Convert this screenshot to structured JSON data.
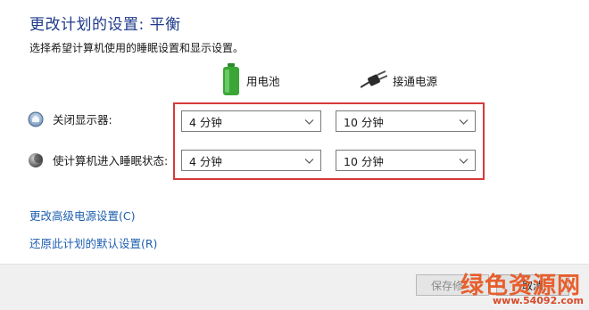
{
  "header": {
    "title": "更改计划的设置: 平衡",
    "subtitle": "选择希望计算机使用的睡眠设置和显示设置。"
  },
  "columns": {
    "battery_label": "用电池",
    "plugged_label": "接通电源",
    "battery_icon": "battery-icon",
    "plugged_icon": "power-plug-icon"
  },
  "settings": [
    {
      "label": "关闭显示器:",
      "icon": "display-icon",
      "battery_value": "4 分钟",
      "plugged_value": "10 分钟"
    },
    {
      "label": "使计算机进入睡眠状态:",
      "icon": "sleep-moon-icon",
      "battery_value": "4 分钟",
      "plugged_value": "10 分钟"
    }
  ],
  "links": {
    "advanced": "更改高级电源设置(C)",
    "restore": "还原此计划的默认设置(R)"
  },
  "footer": {
    "save_label": "保存修",
    "cancel_label": "取消"
  },
  "watermark": {
    "text": "绿色资源网",
    "domain": "www.54092.com"
  },
  "colors": {
    "title": "#1e3a8a",
    "link": "#1e5fb0",
    "highlight": "#d63b3b",
    "battery": "#3aa635",
    "watermark": "#e8541e"
  }
}
